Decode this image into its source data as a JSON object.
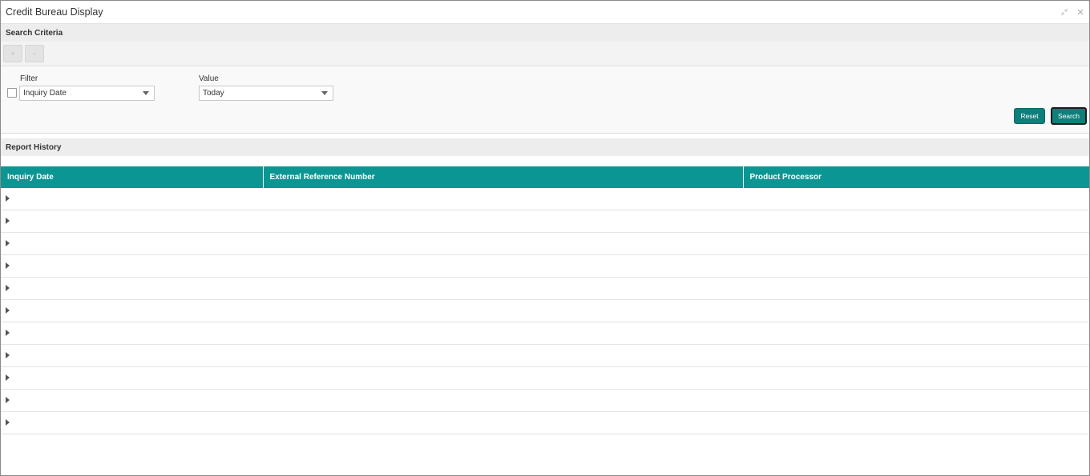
{
  "window": {
    "title": "Credit Bureau Display"
  },
  "search_criteria": {
    "header": "Search Criteria",
    "filter": {
      "label": "Filter",
      "selected": "Inquiry Date"
    },
    "value": {
      "label": "Value",
      "selected": "Today"
    },
    "reset_label": "Reset",
    "search_label": "Search"
  },
  "report_history": {
    "header": "Report History",
    "columns": [
      "Inquiry Date",
      "External Reference Number",
      "Product Processor"
    ],
    "rows": [
      {
        "inquiry_date": "",
        "external_ref": "",
        "processor": ""
      },
      {
        "inquiry_date": "",
        "external_ref": "",
        "processor": ""
      },
      {
        "inquiry_date": "",
        "external_ref": "",
        "processor": ""
      },
      {
        "inquiry_date": "",
        "external_ref": "",
        "processor": ""
      },
      {
        "inquiry_date": "",
        "external_ref": "",
        "processor": ""
      },
      {
        "inquiry_date": "",
        "external_ref": "",
        "processor": ""
      },
      {
        "inquiry_date": "",
        "external_ref": "",
        "processor": ""
      },
      {
        "inquiry_date": "",
        "external_ref": "",
        "processor": ""
      },
      {
        "inquiry_date": "",
        "external_ref": "",
        "processor": ""
      },
      {
        "inquiry_date": "",
        "external_ref": "",
        "processor": ""
      },
      {
        "inquiry_date": "",
        "external_ref": "",
        "processor": ""
      }
    ]
  },
  "icons": {
    "window_controls": [
      "minimize-arrows-icon",
      "close-icon"
    ],
    "row_expander": "caret-right-icon",
    "dropdown": "caret-down-icon"
  },
  "colors": {
    "accent": "#0e7f7a",
    "grid_header": "#0c9693"
  }
}
